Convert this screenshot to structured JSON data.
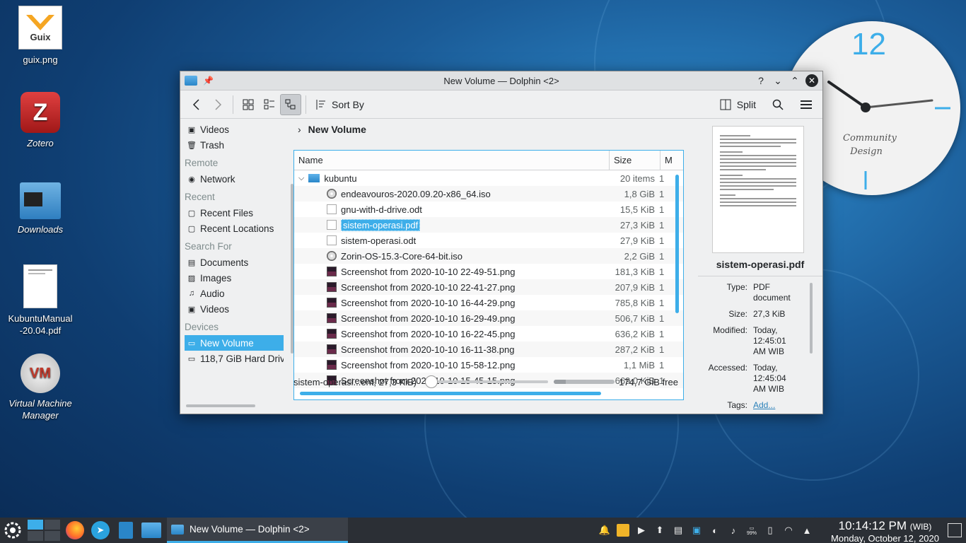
{
  "desktop": {
    "icons": [
      {
        "label": "guix.png",
        "italic": false,
        "text_on_image": "Guix"
      },
      {
        "label": "Zotero",
        "italic": true
      },
      {
        "label": "Downloads",
        "italic": true
      },
      {
        "label": "KubuntuManual\n-20.04.pdf",
        "italic": false
      },
      {
        "label": "Virtual Machine Manager",
        "italic": true
      }
    ],
    "clock_widget": {
      "hour_label": "12",
      "caption_line1": "Community",
      "caption_line2": "Design"
    }
  },
  "window": {
    "title": "New Volume — Dolphin <2>",
    "buttons": {
      "help": "?",
      "minimize": "⌄",
      "maximize": "⌃",
      "close": "✕"
    },
    "toolbar": {
      "sort_label": "Sort By",
      "split_label": "Split"
    },
    "places": {
      "top_items": [
        {
          "icon": "video-icon",
          "label": "Videos"
        },
        {
          "icon": "trash-icon",
          "label": "Trash"
        }
      ],
      "sections": [
        {
          "title": "Remote",
          "items": [
            {
              "icon": "network-icon",
              "label": "Network"
            }
          ]
        },
        {
          "title": "Recent",
          "items": [
            {
              "icon": "recent-files-icon",
              "label": "Recent Files"
            },
            {
              "icon": "recent-locations-icon",
              "label": "Recent Locations"
            }
          ]
        },
        {
          "title": "Search For",
          "items": [
            {
              "icon": "documents-icon",
              "label": "Documents"
            },
            {
              "icon": "images-icon",
              "label": "Images"
            },
            {
              "icon": "audio-icon",
              "label": "Audio"
            },
            {
              "icon": "video-icon",
              "label": "Videos"
            }
          ]
        },
        {
          "title": "Devices",
          "items": [
            {
              "icon": "drive-icon",
              "label": "New Volume",
              "selected": true
            },
            {
              "icon": "drive-icon",
              "label": "118,7 GiB Hard Drive"
            }
          ]
        }
      ]
    },
    "breadcrumb": "New Volume",
    "columns": {
      "name": "Name",
      "size": "Size",
      "modified": "M"
    },
    "folder": {
      "name": "kubuntu",
      "size": "20 items",
      "m": "1"
    },
    "files": [
      {
        "name": "endeavouros-2020.09.20-x86_64.iso",
        "size": "1,8 GiB",
        "m": "1",
        "type": "iso"
      },
      {
        "name": "gnu-with-d-drive.odt",
        "size": "15,5 KiB",
        "m": "1",
        "type": "doc"
      },
      {
        "name": "sistem-operasi.pdf",
        "size": "27,3 KiB",
        "m": "1",
        "type": "doc",
        "selected": true
      },
      {
        "name": "sistem-operasi.odt",
        "size": "27,9 KiB",
        "m": "1",
        "type": "doc"
      },
      {
        "name": "Zorin-OS-15.3-Core-64-bit.iso",
        "size": "2,2 GiB",
        "m": "1",
        "type": "iso"
      },
      {
        "name": "Screenshot from 2020-10-10 22-49-51.png",
        "size": "181,3 KiB",
        "m": "1",
        "type": "img"
      },
      {
        "name": "Screenshot from 2020-10-10 22-41-27.png",
        "size": "207,9 KiB",
        "m": "1",
        "type": "img"
      },
      {
        "name": "Screenshot from 2020-10-10 16-44-29.png",
        "size": "785,8 KiB",
        "m": "1",
        "type": "img"
      },
      {
        "name": "Screenshot from 2020-10-10 16-29-49.png",
        "size": "506,7 KiB",
        "m": "1",
        "type": "img"
      },
      {
        "name": "Screenshot from 2020-10-10 16-22-45.png",
        "size": "636,2 KiB",
        "m": "1",
        "type": "img"
      },
      {
        "name": "Screenshot from 2020-10-10 16-11-38.png",
        "size": "287,2 KiB",
        "m": "1",
        "type": "img"
      },
      {
        "name": "Screenshot from 2020-10-10 15-58-12.png",
        "size": "1,1 MiB",
        "m": "1",
        "type": "img"
      },
      {
        "name": "Screenshot from 2020-10-10 15-45-15.png",
        "size": "669,0 KiB",
        "m": "1",
        "type": "img"
      }
    ],
    "status_text": "sistem-operasi...ent, 27,3 KiB)",
    "free_space": "174,7 GiB free",
    "used_fraction": 0.2,
    "info": {
      "filename": "sistem-operasi.pdf",
      "meta": [
        {
          "key": "Type:",
          "value": "PDF document"
        },
        {
          "key": "Size:",
          "value": "27,3 KiB"
        },
        {
          "key": "Modified:",
          "value": "Today, 12:45:01 AM WIB"
        },
        {
          "key": "Accessed:",
          "value": "Today, 12:45:04 AM WIB"
        }
      ],
      "tags_key": "Tags:",
      "tags_link": "Add..."
    }
  },
  "taskbar": {
    "task_label": "New Volume — Dolphin <2>",
    "time": "10:14:12 PM",
    "timezone": "(WIB)",
    "date": "Monday, October 12, 2020",
    "battery": "99%",
    "accent": "#3daee9"
  }
}
